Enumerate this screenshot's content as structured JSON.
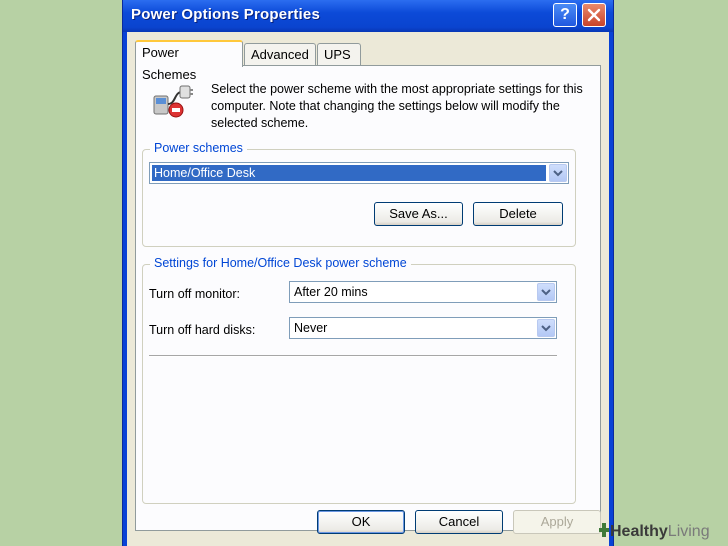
{
  "window": {
    "title": "Power Options Properties"
  },
  "tabs": [
    "Power Schemes",
    "Advanced",
    "UPS"
  ],
  "intro": "Select the power scheme with the most appropriate settings for this computer. Note that changing the settings below will modify the selected scheme.",
  "schemes": {
    "label": "Power schemes",
    "selected": "Home/Office Desk",
    "save_as_label": "Save As...",
    "delete_label": "Delete"
  },
  "settings": {
    "label": "Settings for Home/Office Desk power scheme",
    "monitor_label": "Turn off monitor:",
    "monitor_value": "After 20 mins",
    "disks_label": "Turn off hard disks:",
    "disks_value": "Never"
  },
  "buttons": {
    "ok": "OK",
    "cancel": "Cancel",
    "apply": "Apply"
  },
  "watermark": {
    "brand": "Healthy",
    "suffix": "Living"
  },
  "icons": [
    "help-icon",
    "close-icon",
    "power-plug-icon",
    "chevron-down-icon",
    "cross-icon"
  ]
}
